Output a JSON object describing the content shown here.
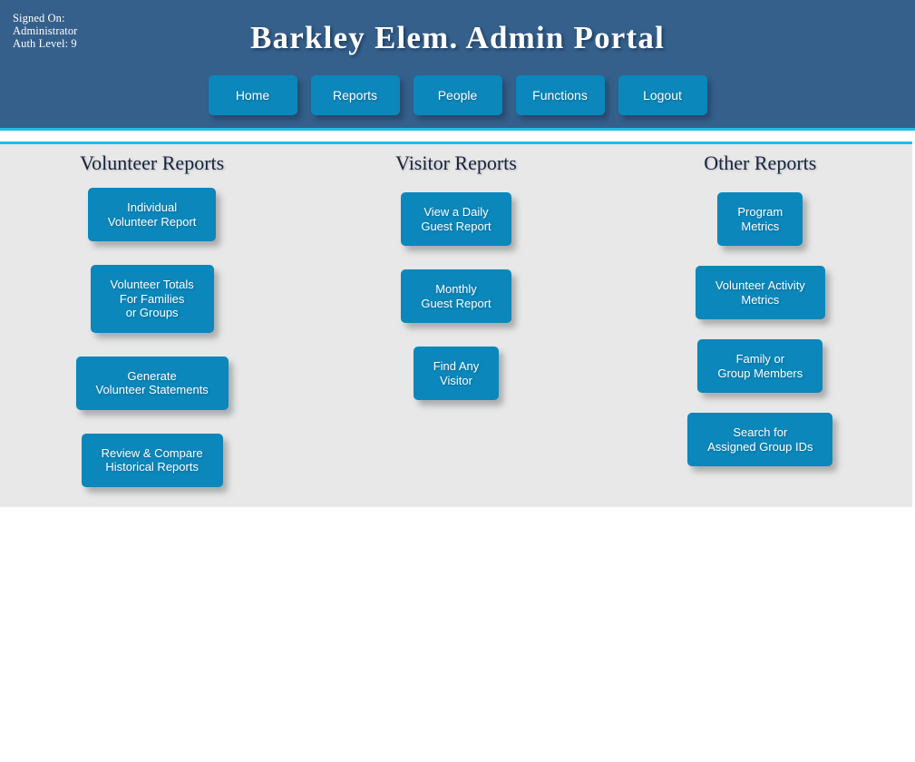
{
  "header": {
    "session": {
      "line1": "Signed On:",
      "line2": "Administrator",
      "line3": "Auth Level: 9"
    },
    "title": "Barkley Elem. Admin Portal",
    "nav": [
      {
        "label": "Home"
      },
      {
        "label": "Reports"
      },
      {
        "label": "People"
      },
      {
        "label": "Functions"
      },
      {
        "label": "Logout"
      }
    ]
  },
  "content": {
    "columns": [
      {
        "title": "Volunteer Reports",
        "buttons": [
          {
            "label": "Individual\nVolunteer Report"
          },
          {
            "label": "Volunteer Totals\nFor Families\nor Groups"
          },
          {
            "label": "Generate\nVolunteer Statements"
          },
          {
            "label": "Review & Compare\nHistorical Reports"
          }
        ]
      },
      {
        "title": "Visitor Reports",
        "buttons": [
          {
            "label": "View a Daily\nGuest Report"
          },
          {
            "label": "Monthly\nGuest Report"
          },
          {
            "label": "Find Any\nVisitor"
          }
        ]
      },
      {
        "title": "Other Reports",
        "buttons": [
          {
            "label": "Program\nMetrics"
          },
          {
            "label": "Volunteer Activity\nMetrics"
          },
          {
            "label": "Family or\nGroup Members"
          },
          {
            "label": "Search for\nAssigned Group IDs"
          }
        ]
      }
    ]
  },
  "colors": {
    "header_navy": "#35608c",
    "accent_cyan": "#17bfec",
    "button_blue": "#0b87bb",
    "content_gray": "#e8e8e8",
    "title_text": "#ffffff",
    "heading_text": "#16233c"
  }
}
